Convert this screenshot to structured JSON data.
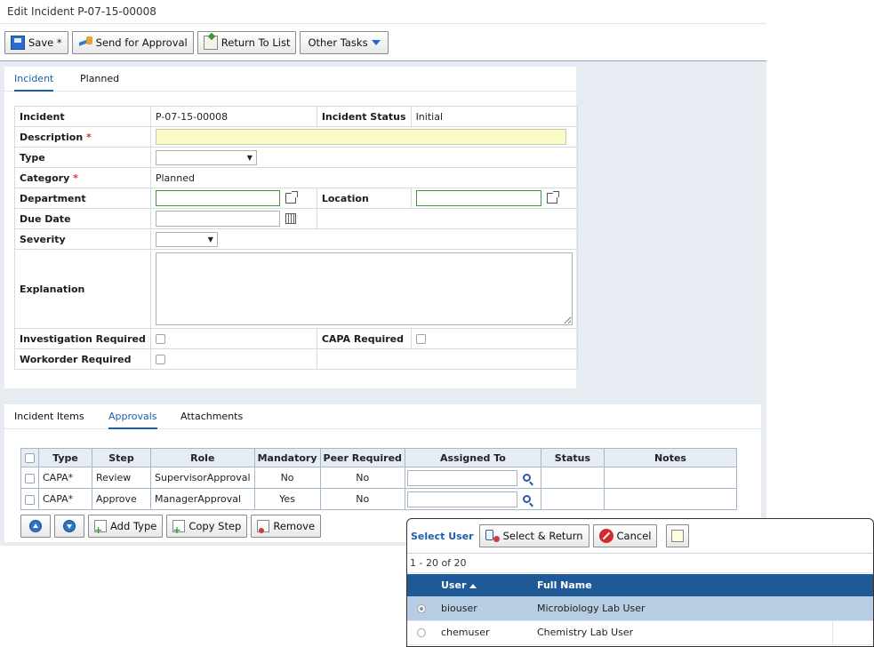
{
  "page": {
    "title": "Edit Incident P-07-15-00008"
  },
  "toolbar": {
    "save": "Save *",
    "send_for_approval": "Send for Approval",
    "return_to_list": "Return To List",
    "other_tasks": "Other Tasks"
  },
  "top_tabs": [
    "Incident",
    "Planned"
  ],
  "form": {
    "incident_label": "Incident",
    "incident_value": "P-07-15-00008",
    "incident_status_label": "Incident Status",
    "incident_status_value": "Initial",
    "description_label": "Description",
    "description_value": "",
    "type_label": "Type",
    "type_value": "",
    "category_label": "Category",
    "category_value": "Planned",
    "department_label": "Department",
    "department_value": "",
    "location_label": "Location",
    "location_value": "",
    "due_date_label": "Due Date",
    "due_date_value": "",
    "severity_label": "Severity",
    "severity_value": "",
    "explanation_label": "Explanation",
    "explanation_value": "",
    "investigation_required_label": "Investigation Required",
    "capa_required_label": "CAPA Required",
    "workorder_required_label": "Workorder Required",
    "required_marker": "*"
  },
  "bottom_tabs": [
    "Incident Items",
    "Approvals",
    "Attachments"
  ],
  "approvals": {
    "columns": [
      "Type",
      "Step",
      "Role",
      "Mandatory",
      "Peer Required",
      "Assigned To",
      "Status",
      "Notes"
    ],
    "rows": [
      {
        "type": "CAPA*",
        "step": "Review",
        "role": "SupervisorApproval",
        "mandatory": "No",
        "peer": "No",
        "assigned": "",
        "status": "",
        "notes": ""
      },
      {
        "type": "CAPA*",
        "step": "Approve",
        "role": "ManagerApproval",
        "mandatory": "Yes",
        "peer": "No",
        "assigned": "",
        "status": "",
        "notes": ""
      }
    ],
    "buttons": {
      "add_type": "Add Type",
      "copy_step": "Copy Step",
      "remove": "Remove"
    }
  },
  "popup": {
    "title": "Select User",
    "select_return": "Select & Return",
    "cancel": "Cancel",
    "count": "1 - 20 of 20",
    "columns": [
      "User",
      "Full Name"
    ],
    "rows": [
      {
        "user": "biouser",
        "full_name": "Microbiology Lab User",
        "selected": true
      },
      {
        "user": "chemuser",
        "full_name": "Chemistry Lab User",
        "selected": false
      }
    ]
  },
  "colors": {
    "accent": "#1d5ea8",
    "grid_header": "#1f5a97",
    "selected_row": "#b6cde3",
    "required_field": "#fbfbc8"
  }
}
